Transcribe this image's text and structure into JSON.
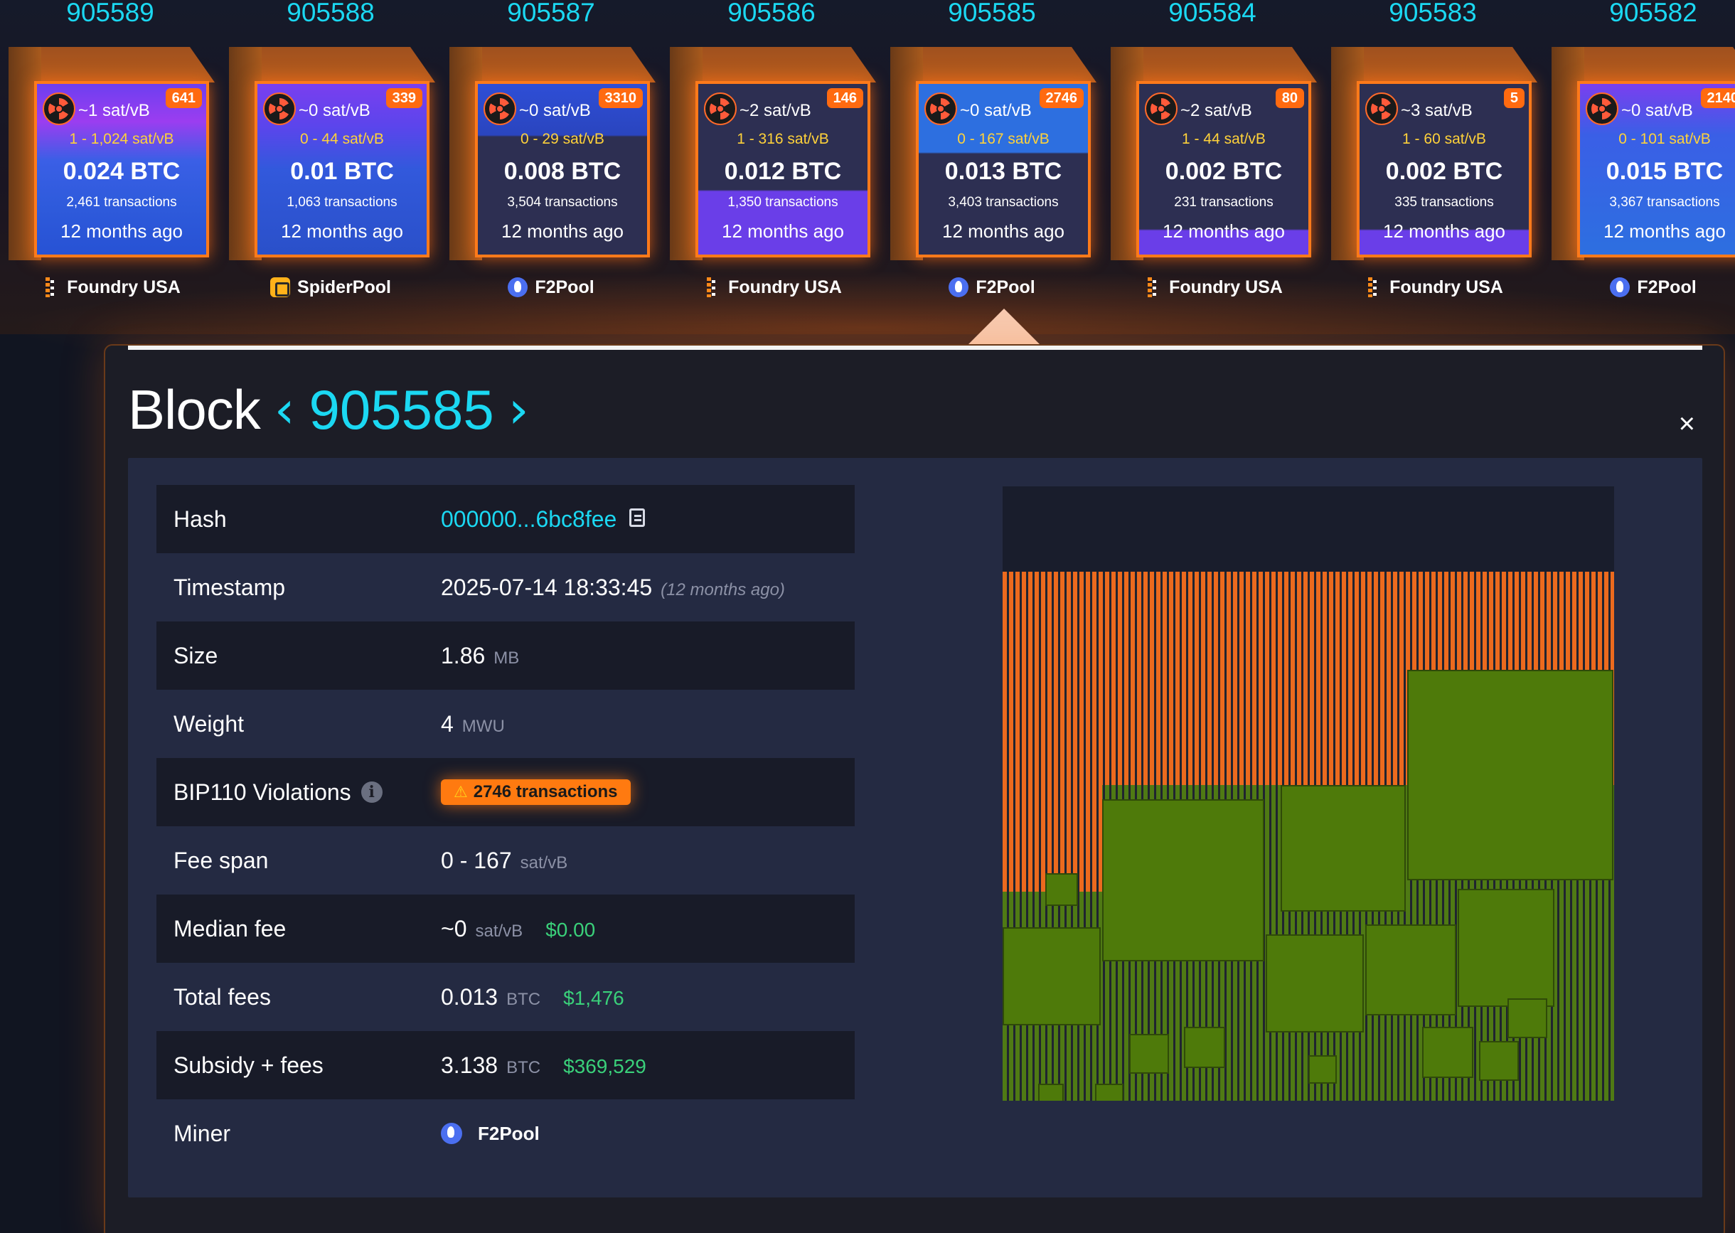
{
  "colors": {
    "accent": "#1bd8f2",
    "violation": "#ff7a10",
    "usd": "#3ad07a",
    "block_border": "#ff7a1a",
    "treemap_orange": "#ec6a1e",
    "treemap_green": "#4e7a0a"
  },
  "blocks": [
    {
      "height": "905589",
      "median": "~1 sat/vB",
      "badge": "641",
      "range": "1 - 1,024 sat/vB",
      "total": "0.024 BTC",
      "txs": "2,461 transactions",
      "ago": "12 months ago",
      "miner": "Foundry USA",
      "miner_icon": "foundry-icon",
      "fill": "fill-rainbow"
    },
    {
      "height": "905588",
      "median": "~0 sat/vB",
      "badge": "339",
      "range": "0 - 44 sat/vB",
      "total": "0.01 BTC",
      "txs": "1,063 transactions",
      "ago": "12 months ago",
      "miner": "SpiderPool",
      "miner_icon": "spiderpool-icon",
      "fill": "fill-top-purple"
    },
    {
      "height": "905587",
      "median": "~0 sat/vB",
      "badge": "3310",
      "range": "0 - 29 sat/vB",
      "total": "0.008 BTC",
      "txs": "3,504 transactions",
      "ago": "12 months ago",
      "miner": "F2Pool",
      "miner_icon": "f2pool-icon",
      "fill": "fill-blue-top"
    },
    {
      "height": "905586",
      "median": "~2 sat/vB",
      "badge": "146",
      "range": "1 - 316 sat/vB",
      "total": "0.012 BTC",
      "txs": "1,350 transactions",
      "ago": "12 months ago",
      "miner": "Foundry USA",
      "miner_icon": "foundry-icon",
      "fill": "fill-bottom-purple"
    },
    {
      "height": "905585",
      "median": "~0 sat/vB",
      "badge": "2746",
      "range": "0 - 167 sat/vB",
      "total": "0.013 BTC",
      "txs": "3,403 transactions",
      "ago": "12 months ago",
      "miner": "F2Pool",
      "miner_icon": "f2pool-icon",
      "fill": "fill-mid-blue"
    },
    {
      "height": "905584",
      "median": "~2 sat/vB",
      "badge": "80",
      "range": "1 - 44 sat/vB",
      "total": "0.002 BTC",
      "txs": "231 transactions",
      "ago": "12 months ago",
      "miner": "Foundry USA",
      "miner_icon": "foundry-icon",
      "fill": "fill-dark-band"
    },
    {
      "height": "905583",
      "median": "~3 sat/vB",
      "badge": "5",
      "range": "1 - 60 sat/vB",
      "total": "0.002 BTC",
      "txs": "335 transactions",
      "ago": "12 months ago",
      "miner": "Foundry USA",
      "miner_icon": "foundry-icon",
      "fill": "fill-dark-band"
    },
    {
      "height": "905582",
      "median": "~0 sat/vB",
      "badge": "2140",
      "range": "0 - 101 sat/vB",
      "total": "0.015 BTC",
      "txs": "3,367 transactions",
      "ago": "12 months ago",
      "miner": "F2Pool",
      "miner_icon": "f2pool-icon",
      "fill": "fill-blue-full"
    }
  ],
  "panel": {
    "title_label": "Block",
    "prev_icon": "chevron-left-icon",
    "next_icon": "chevron-right-icon",
    "block_height": "905585",
    "close_glyph": "×",
    "details": {
      "hash_label": "Hash",
      "hash_value": "000000...6bc8fee",
      "timestamp_label": "Timestamp",
      "timestamp_value": "2025-07-14 18:33:45",
      "timestamp_ago": "(12 months ago)",
      "size_label": "Size",
      "size_value": "1.86",
      "size_unit": "MB",
      "weight_label": "Weight",
      "weight_value": "4",
      "weight_unit": "MWU",
      "bip_label": "BIP110 Violations",
      "bip_info_glyph": "i",
      "bip_warn_glyph": "⚠",
      "bip_value": "2746 transactions",
      "feespan_label": "Fee span",
      "feespan_value": "0 - 167",
      "feespan_unit": "sat/vB",
      "median_label": "Median fee",
      "median_value": "~0",
      "median_unit": "sat/vB",
      "median_usd": "$0.00",
      "totalfees_label": "Total fees",
      "totalfees_value": "0.013",
      "totalfees_unit": "BTC",
      "totalfees_usd": "$1,476",
      "subsidy_label": "Subsidy + fees",
      "subsidy_value": "3.138",
      "subsidy_unit": "BTC",
      "subsidy_usd": "$369,529",
      "miner_label": "Miner",
      "miner_value": "F2Pool"
    }
  }
}
